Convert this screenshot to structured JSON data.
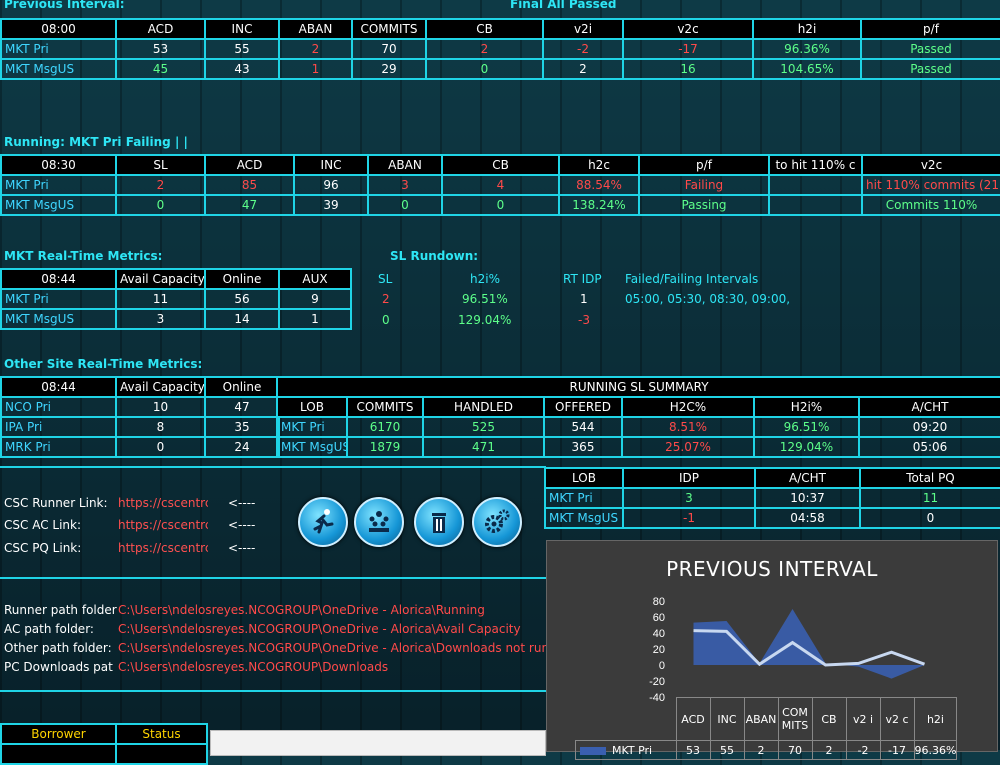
{
  "prev": {
    "title": "Previous Interval:",
    "status": "Final  All Passed",
    "headers": [
      "08:00",
      "ACD",
      "INC",
      "ABAN",
      "COMMITS",
      "CB",
      "v2i",
      "v2c",
      "h2i",
      "p/f"
    ],
    "rows": [
      {
        "label": "MKT Pri",
        "cells": [
          "53",
          "55",
          "2",
          "70",
          "2",
          "-2",
          "-17",
          "96.36%",
          "Passed"
        ]
      },
      {
        "label": "MKT MsgUS",
        "cells": [
          "45",
          "43",
          "1",
          "29",
          "0",
          "2",
          "16",
          "104.65%",
          "Passed"
        ]
      }
    ]
  },
  "running": {
    "title": "Running: MKT Pri Failing   | |",
    "headers": [
      "08:30",
      "SL",
      "ACD",
      "INC",
      "ABAN",
      "CB",
      "h2c",
      "p/f",
      "to hit 110% c",
      "v2c"
    ],
    "rows": [
      {
        "label": "MKT Pri",
        "cells": [
          "2",
          "85",
          "96",
          "3",
          "4",
          "88.54%",
          "Failing",
          "",
          "hit 110% commits (21)"
        ]
      },
      {
        "label": "MKT MsgUS",
        "cells": [
          "0",
          "47",
          "39",
          "0",
          "0",
          "138.24%",
          "Passing",
          "",
          "Commits 110%"
        ]
      }
    ]
  },
  "rt": {
    "title": "MKT Real-Time Metrics:",
    "headers": [
      "08:44",
      "Avail Capacity",
      "Online",
      "AUX"
    ],
    "rows": [
      {
        "label": "MKT Pri",
        "cells": [
          "11",
          "56",
          "9"
        ]
      },
      {
        "label": "MKT MsgUS",
        "cells": [
          "3",
          "14",
          "1"
        ]
      }
    ]
  },
  "rundown": {
    "title": "SL Rundown:",
    "headers": [
      "SL",
      "h2i%",
      "RT IDP",
      "Failed/Failing Intervals"
    ],
    "rows": [
      {
        "sl": "2",
        "h2i": "96.51%",
        "idp": "1",
        "intervals": "05:00, 05:30, 08:30, 09:00,"
      },
      {
        "sl": "0",
        "h2i": "129.04%",
        "idp": "-3",
        "intervals": ""
      }
    ]
  },
  "other": {
    "title": "Other Site Real-Time Metrics:",
    "headers": [
      "08:44",
      "Avail Capacity",
      "Online"
    ],
    "rows": [
      {
        "label": "NCO Pri",
        "cells": [
          "10",
          "47"
        ]
      },
      {
        "label": "IPA Pri",
        "cells": [
          "8",
          "35"
        ]
      },
      {
        "label": "MRK Pri",
        "cells": [
          "0",
          "24"
        ]
      }
    ]
  },
  "summary": {
    "title": "RUNNING SL SUMMARY",
    "headers": [
      "LOB",
      "COMMITS",
      "HANDLED",
      "OFFERED",
      "H2C%",
      "H2i%",
      "A/CHT"
    ],
    "rows": [
      {
        "label": "MKT Pri",
        "cells": [
          "6170",
          "525",
          "544",
          "8.51%",
          "96.51%",
          "09:20"
        ]
      },
      {
        "label": "MKT MsgUS",
        "cells": [
          "1879",
          "471",
          "365",
          "25.07%",
          "129.04%",
          "05:06"
        ]
      }
    ]
  },
  "idp": {
    "headers": [
      "LOB",
      "IDP",
      "A/CHT",
      "Total PQ"
    ],
    "rows": [
      {
        "label": "MKT Pri",
        "cells": [
          "3",
          "10:37",
          "11"
        ]
      },
      {
        "label": "MKT MsgUS",
        "cells": [
          "-1",
          "04:58",
          "0"
        ]
      }
    ]
  },
  "links": [
    {
      "label": "CSC Runner Link:",
      "url": "https://cscentrc",
      "arrow": "<----"
    },
    {
      "label": "CSC AC Link:",
      "url": "https://cscentrc",
      "arrow": "<----"
    },
    {
      "label": "CSC PQ Link:",
      "url": "https://cscentrc",
      "arrow": "<----"
    }
  ],
  "buttons": {
    "icons": [
      "runner-icon",
      "team-icon",
      "trash-icon",
      "gears-icon"
    ]
  },
  "paths": [
    {
      "label": "Runner path folder",
      "value": "C:\\Users\\ndelosreyes.NCOGROUP\\OneDrive - Alorica\\Running"
    },
    {
      "label": "AC path folder:",
      "value": "C:\\Users\\ndelosreyes.NCOGROUP\\OneDrive - Alorica\\Avail Capacity"
    },
    {
      "label": "Other path folder:",
      "value": "C:\\Users\\ndelosreyes.NCOGROUP\\OneDrive - Alorica\\Downloads not runn"
    },
    {
      "label": "PC Downloads pat",
      "value": "C:\\Users\\ndelosreyes.NCOGROUP\\Downloads"
    }
  ],
  "borrower": {
    "headers": [
      "Borrower",
      "Status"
    ]
  },
  "chart_data": {
    "type": "area",
    "title": "PREVIOUS INTERVAL",
    "categories": [
      "ACD",
      "INC",
      "ABAN",
      "COMMITS",
      "CB",
      "v2i",
      "v2c",
      "h2i"
    ],
    "category_labels": [
      [
        "ACD"
      ],
      [
        "INC"
      ],
      [
        "ABAN"
      ],
      [
        "COM",
        "MITS"
      ],
      [
        "CB"
      ],
      [
        "v2 i"
      ],
      [
        "v2 c"
      ],
      [
        "h2i"
      ]
    ],
    "series": [
      {
        "name": "MKT Pri",
        "values": [
          53,
          55,
          2,
          70,
          2,
          -2,
          -17,
          96.36
        ],
        "display": [
          "53",
          "55",
          "2",
          "70",
          "2",
          "-2",
          "-17",
          "96.36%"
        ]
      }
    ],
    "series_display_values": [
      43,
      42,
      1,
      28,
      0,
      2,
      16,
      1.05
    ],
    "ylim": [
      -40,
      80
    ],
    "yticks": [
      80,
      60,
      40,
      20,
      0,
      -20,
      -40
    ],
    "colors": {
      "area": "#3a5fb0",
      "line": "#c8d8f0",
      "bg": "#3b3b3b"
    }
  }
}
